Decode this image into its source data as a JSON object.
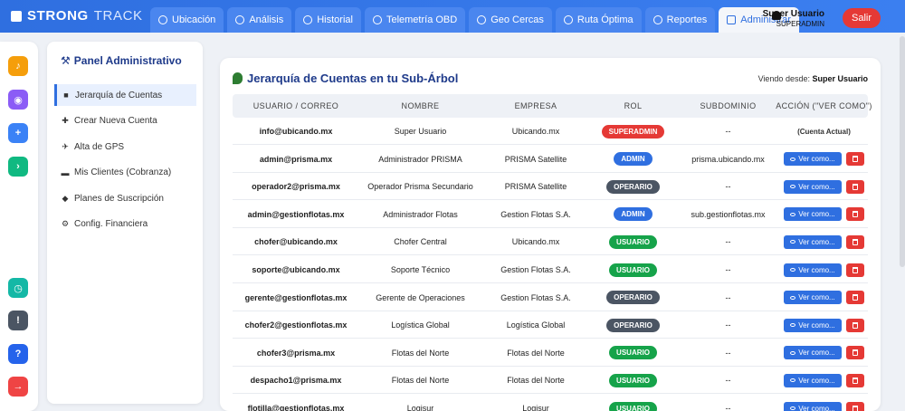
{
  "app": {
    "brand_primary": "STRONG",
    "brand_secondary": "TRACK"
  },
  "colors": {
    "accent": "#2f6fe0",
    "danger": "#e53935",
    "superadmin": "#e53935",
    "admin": "#2f6fe0",
    "operario": "#4b5563",
    "usuario": "#16a34a"
  },
  "nav": {
    "tabs": [
      {
        "label": "Ubicación",
        "icon": "navigation-icon"
      },
      {
        "label": "Análisis",
        "icon": "analytics-icon"
      },
      {
        "label": "Historial",
        "icon": "clock-icon"
      },
      {
        "label": "Telemetría OBD",
        "icon": "telemetry-icon"
      },
      {
        "label": "Geo Cercas",
        "icon": "shield-icon"
      },
      {
        "label": "Ruta Óptima",
        "icon": "route-icon"
      },
      {
        "label": "Reportes",
        "icon": "bar-chart-icon"
      },
      {
        "label": "Administrar",
        "icon": "admin-icon"
      }
    ]
  },
  "user": {
    "name": "Super Usuario",
    "role": "SUPERADMIN",
    "logout_label": "Salir"
  },
  "rail": {
    "icons": [
      "bell-icon",
      "map-pin-icon",
      "add-user-icon",
      "terminal-icon",
      "timer-icon",
      "alert-icon",
      "help-icon",
      "logout-icon"
    ]
  },
  "panel": {
    "title": "Panel Administrativo",
    "items": [
      {
        "label": "Jerarquía de Cuentas",
        "icon": "users-icon"
      },
      {
        "label": "Crear Nueva Cuenta",
        "icon": "plus-icon"
      },
      {
        "label": "Alta de GPS",
        "icon": "gps-icon"
      },
      {
        "label": "Mis Clientes (Cobranza)",
        "icon": "card-icon"
      },
      {
        "label": "Planes de Suscripción",
        "icon": "tag-icon"
      },
      {
        "label": "Config. Financiera",
        "icon": "settings-icon"
      }
    ]
  },
  "main": {
    "title": "Jerarquía de Cuentas en tu Sub-Árbol",
    "viewing_label": "Viendo desde:",
    "viewing_user": "Super Usuario",
    "columns": [
      "USUARIO / CORREO",
      "NOMBRE",
      "EMPRESA",
      "ROL",
      "SUBDOMINIO",
      "ACCIÓN (\"VER COMO\")"
    ],
    "view_label": "Ver como...",
    "current_label": "(Cuenta Actual)",
    "rows": [
      {
        "email": "info@ubicando.mx",
        "name": "Super Usuario",
        "company": "Ubicando.mx",
        "role": "SUPERADMIN",
        "subdomain": "--",
        "current": true
      },
      {
        "email": "admin@prisma.mx",
        "name": "Administrador PRISMA",
        "company": "PRISMA Satellite",
        "role": "ADMIN",
        "subdomain": "prisma.ubicando.mx",
        "current": false
      },
      {
        "email": "operador2@prisma.mx",
        "name": "Operador Prisma Secundario",
        "company": "PRISMA Satellite",
        "role": "OPERARIO",
        "subdomain": "--",
        "current": false
      },
      {
        "email": "admin@gestionflotas.mx",
        "name": "Administrador Flotas",
        "company": "Gestion Flotas S.A.",
        "role": "ADMIN",
        "subdomain": "sub.gestionflotas.mx",
        "current": false
      },
      {
        "email": "chofer@ubicando.mx",
        "name": "Chofer Central",
        "company": "Ubicando.mx",
        "role": "USUARIO",
        "subdomain": "--",
        "current": false
      },
      {
        "email": "soporte@ubicando.mx",
        "name": "Soporte Técnico",
        "company": "Gestion Flotas S.A.",
        "role": "USUARIO",
        "subdomain": "--",
        "current": false
      },
      {
        "email": "gerente@gestionflotas.mx",
        "name": "Gerente de Operaciones",
        "company": "Gestion Flotas S.A.",
        "role": "OPERARIO",
        "subdomain": "--",
        "current": false
      },
      {
        "email": "chofer2@gestionflotas.mx",
        "name": "Logística Global",
        "company": "Logística Global",
        "role": "OPERARIO",
        "subdomain": "--",
        "current": false
      },
      {
        "email": "chofer3@prisma.mx",
        "name": "Flotas del Norte",
        "company": "Flotas del Norte",
        "role": "USUARIO",
        "subdomain": "--",
        "current": false
      },
      {
        "email": "despacho1@prisma.mx",
        "name": "Flotas del Norte",
        "company": "Flotas del Norte",
        "role": "USUARIO",
        "subdomain": "--",
        "current": false
      },
      {
        "email": "flotilla@gestionflotas.mx",
        "name": "Logisur",
        "company": "Logisur",
        "role": "USUARIO",
        "subdomain": "--",
        "current": false
      }
    ]
  }
}
